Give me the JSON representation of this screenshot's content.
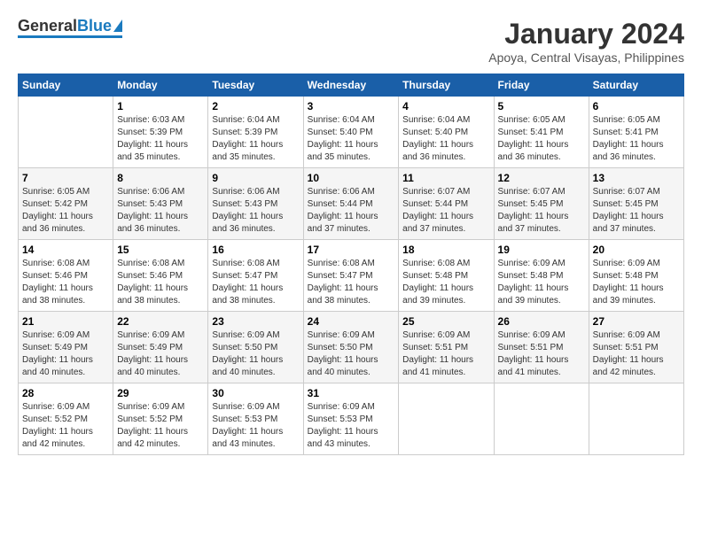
{
  "logo": {
    "text_general": "General",
    "text_blue": "Blue"
  },
  "title": "January 2024",
  "subtitle": "Apoya, Central Visayas, Philippines",
  "days_of_week": [
    "Sunday",
    "Monday",
    "Tuesday",
    "Wednesday",
    "Thursday",
    "Friday",
    "Saturday"
  ],
  "weeks": [
    [
      {
        "day": "",
        "sunrise": "",
        "sunset": "",
        "daylight": ""
      },
      {
        "day": "1",
        "sunrise": "Sunrise: 6:03 AM",
        "sunset": "Sunset: 5:39 PM",
        "daylight": "Daylight: 11 hours and 35 minutes."
      },
      {
        "day": "2",
        "sunrise": "Sunrise: 6:04 AM",
        "sunset": "Sunset: 5:39 PM",
        "daylight": "Daylight: 11 hours and 35 minutes."
      },
      {
        "day": "3",
        "sunrise": "Sunrise: 6:04 AM",
        "sunset": "Sunset: 5:40 PM",
        "daylight": "Daylight: 11 hours and 35 minutes."
      },
      {
        "day": "4",
        "sunrise": "Sunrise: 6:04 AM",
        "sunset": "Sunset: 5:40 PM",
        "daylight": "Daylight: 11 hours and 36 minutes."
      },
      {
        "day": "5",
        "sunrise": "Sunrise: 6:05 AM",
        "sunset": "Sunset: 5:41 PM",
        "daylight": "Daylight: 11 hours and 36 minutes."
      },
      {
        "day": "6",
        "sunrise": "Sunrise: 6:05 AM",
        "sunset": "Sunset: 5:41 PM",
        "daylight": "Daylight: 11 hours and 36 minutes."
      }
    ],
    [
      {
        "day": "7",
        "sunrise": "Sunrise: 6:05 AM",
        "sunset": "Sunset: 5:42 PM",
        "daylight": "Daylight: 11 hours and 36 minutes."
      },
      {
        "day": "8",
        "sunrise": "Sunrise: 6:06 AM",
        "sunset": "Sunset: 5:43 PM",
        "daylight": "Daylight: 11 hours and 36 minutes."
      },
      {
        "day": "9",
        "sunrise": "Sunrise: 6:06 AM",
        "sunset": "Sunset: 5:43 PM",
        "daylight": "Daylight: 11 hours and 36 minutes."
      },
      {
        "day": "10",
        "sunrise": "Sunrise: 6:06 AM",
        "sunset": "Sunset: 5:44 PM",
        "daylight": "Daylight: 11 hours and 37 minutes."
      },
      {
        "day": "11",
        "sunrise": "Sunrise: 6:07 AM",
        "sunset": "Sunset: 5:44 PM",
        "daylight": "Daylight: 11 hours and 37 minutes."
      },
      {
        "day": "12",
        "sunrise": "Sunrise: 6:07 AM",
        "sunset": "Sunset: 5:45 PM",
        "daylight": "Daylight: 11 hours and 37 minutes."
      },
      {
        "day": "13",
        "sunrise": "Sunrise: 6:07 AM",
        "sunset": "Sunset: 5:45 PM",
        "daylight": "Daylight: 11 hours and 37 minutes."
      }
    ],
    [
      {
        "day": "14",
        "sunrise": "Sunrise: 6:08 AM",
        "sunset": "Sunset: 5:46 PM",
        "daylight": "Daylight: 11 hours and 38 minutes."
      },
      {
        "day": "15",
        "sunrise": "Sunrise: 6:08 AM",
        "sunset": "Sunset: 5:46 PM",
        "daylight": "Daylight: 11 hours and 38 minutes."
      },
      {
        "day": "16",
        "sunrise": "Sunrise: 6:08 AM",
        "sunset": "Sunset: 5:47 PM",
        "daylight": "Daylight: 11 hours and 38 minutes."
      },
      {
        "day": "17",
        "sunrise": "Sunrise: 6:08 AM",
        "sunset": "Sunset: 5:47 PM",
        "daylight": "Daylight: 11 hours and 38 minutes."
      },
      {
        "day": "18",
        "sunrise": "Sunrise: 6:08 AM",
        "sunset": "Sunset: 5:48 PM",
        "daylight": "Daylight: 11 hours and 39 minutes."
      },
      {
        "day": "19",
        "sunrise": "Sunrise: 6:09 AM",
        "sunset": "Sunset: 5:48 PM",
        "daylight": "Daylight: 11 hours and 39 minutes."
      },
      {
        "day": "20",
        "sunrise": "Sunrise: 6:09 AM",
        "sunset": "Sunset: 5:48 PM",
        "daylight": "Daylight: 11 hours and 39 minutes."
      }
    ],
    [
      {
        "day": "21",
        "sunrise": "Sunrise: 6:09 AM",
        "sunset": "Sunset: 5:49 PM",
        "daylight": "Daylight: 11 hours and 40 minutes."
      },
      {
        "day": "22",
        "sunrise": "Sunrise: 6:09 AM",
        "sunset": "Sunset: 5:49 PM",
        "daylight": "Daylight: 11 hours and 40 minutes."
      },
      {
        "day": "23",
        "sunrise": "Sunrise: 6:09 AM",
        "sunset": "Sunset: 5:50 PM",
        "daylight": "Daylight: 11 hours and 40 minutes."
      },
      {
        "day": "24",
        "sunrise": "Sunrise: 6:09 AM",
        "sunset": "Sunset: 5:50 PM",
        "daylight": "Daylight: 11 hours and 40 minutes."
      },
      {
        "day": "25",
        "sunrise": "Sunrise: 6:09 AM",
        "sunset": "Sunset: 5:51 PM",
        "daylight": "Daylight: 11 hours and 41 minutes."
      },
      {
        "day": "26",
        "sunrise": "Sunrise: 6:09 AM",
        "sunset": "Sunset: 5:51 PM",
        "daylight": "Daylight: 11 hours and 41 minutes."
      },
      {
        "day": "27",
        "sunrise": "Sunrise: 6:09 AM",
        "sunset": "Sunset: 5:51 PM",
        "daylight": "Daylight: 11 hours and 42 minutes."
      }
    ],
    [
      {
        "day": "28",
        "sunrise": "Sunrise: 6:09 AM",
        "sunset": "Sunset: 5:52 PM",
        "daylight": "Daylight: 11 hours and 42 minutes."
      },
      {
        "day": "29",
        "sunrise": "Sunrise: 6:09 AM",
        "sunset": "Sunset: 5:52 PM",
        "daylight": "Daylight: 11 hours and 42 minutes."
      },
      {
        "day": "30",
        "sunrise": "Sunrise: 6:09 AM",
        "sunset": "Sunset: 5:53 PM",
        "daylight": "Daylight: 11 hours and 43 minutes."
      },
      {
        "day": "31",
        "sunrise": "Sunrise: 6:09 AM",
        "sunset": "Sunset: 5:53 PM",
        "daylight": "Daylight: 11 hours and 43 minutes."
      },
      {
        "day": "",
        "sunrise": "",
        "sunset": "",
        "daylight": ""
      },
      {
        "day": "",
        "sunrise": "",
        "sunset": "",
        "daylight": ""
      },
      {
        "day": "",
        "sunrise": "",
        "sunset": "",
        "daylight": ""
      }
    ]
  ]
}
